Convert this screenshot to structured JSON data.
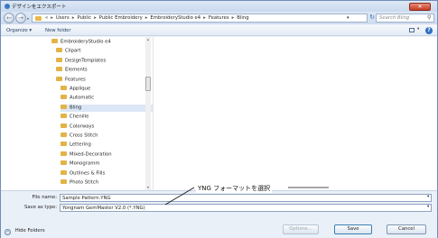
{
  "window": {
    "title": "デザインをエクスポート",
    "close_glyph": "✕"
  },
  "address": {
    "crumbs": [
      "«",
      "Users",
      "Public",
      "Public Embroidery",
      "EmbroideryStudio e4",
      "Features",
      "Bling"
    ],
    "separator": "▸",
    "dropdown_glyph": "▾",
    "refresh_glyph": "↻",
    "search_placeholder": "Search Bling",
    "search_glyph": "⚲"
  },
  "toolbar": {
    "organize_label": "Organize ▾",
    "new_folder_label": "New folder",
    "views_drop_glyph": "▾",
    "help_glyph": "?"
  },
  "tree": {
    "items": [
      {
        "label": "EmbroideryStudio e4",
        "level": 0,
        "selected": false
      },
      {
        "label": "Clipart",
        "level": 1,
        "selected": false
      },
      {
        "label": "DesignTemplates",
        "level": 1,
        "selected": false
      },
      {
        "label": "Elements",
        "level": 1,
        "selected": false
      },
      {
        "label": "Features",
        "level": 1,
        "selected": false
      },
      {
        "label": "Applique",
        "level": 2,
        "selected": false
      },
      {
        "label": "Automatic",
        "level": 2,
        "selected": false
      },
      {
        "label": "Bling",
        "level": 2,
        "selected": true
      },
      {
        "label": "Chenille",
        "level": 2,
        "selected": false
      },
      {
        "label": "Colorways",
        "level": 2,
        "selected": false
      },
      {
        "label": "Cross Stitch",
        "level": 2,
        "selected": false
      },
      {
        "label": "Lettering",
        "level": 2,
        "selected": false
      },
      {
        "label": "Mixed-Decoration",
        "level": 2,
        "selected": false
      },
      {
        "label": "Monogramm",
        "level": 2,
        "selected": false
      },
      {
        "label": "Outlines & Fills",
        "level": 2,
        "selected": false
      },
      {
        "label": "Photo Stitch",
        "level": 2,
        "selected": false
      }
    ],
    "scroll_up_glyph": "▴",
    "scroll_down_glyph": "▾"
  },
  "form": {
    "filename_label": "File name:",
    "filename_value": "Sample Pattern.YNG",
    "savetype_label": "Save as type:",
    "savetype_value": "Yongnam GemMaster V2.0 (*.YNG)",
    "dropdown_glyph": "▾"
  },
  "footer": {
    "hide_folders_label": "Hide Folders",
    "hide_glyph": "^",
    "options_label": "Options...",
    "save_label": "Save",
    "cancel_label": "Cancel"
  },
  "annotation": {
    "text": "YNG フォーマットを選択"
  },
  "colors": {
    "accent": "#2f6fc4",
    "folder": "#e3b347",
    "selection": "#dbe7f6",
    "close": "#c43c24"
  }
}
